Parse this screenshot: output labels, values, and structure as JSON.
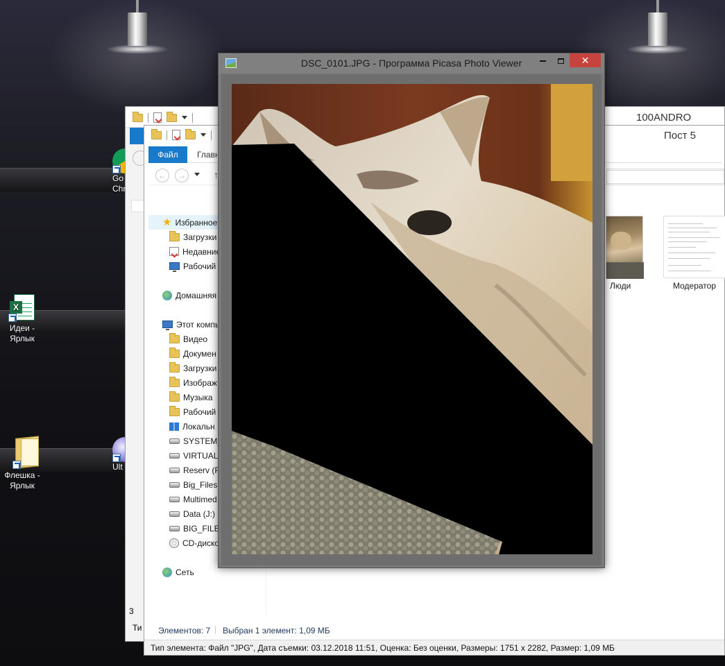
{
  "desktop": {
    "icons": [
      {
        "label": "Go\nChr"
      },
      {
        "label": "Идеи -\nЯрлык"
      },
      {
        "label": "Флешка -\nЯрлык"
      },
      {
        "label": "Ult"
      }
    ]
  },
  "explorer_back": {
    "title": "100ANDRO"
  },
  "explorer_front": {
    "title": "Пост 5",
    "tabs": {
      "file": "Файл",
      "home": "Главн"
    },
    "nav": {
      "back_icon": "arrow-left-icon",
      "forward_icon": "arrow-right-icon",
      "up_icon": "arrow-up-icon"
    },
    "nav_pane": [
      {
        "label": "Избранное",
        "icon": "star-icon"
      },
      {
        "label": "Загрузки",
        "icon": "downloads-folder-icon"
      },
      {
        "label": "Недавние",
        "icon": "recent-places-icon"
      },
      {
        "label": "Рабочий",
        "icon": "desktop-icon"
      },
      {
        "label": "Домашняя",
        "icon": "homegroup-icon"
      },
      {
        "label": "Этот компь",
        "icon": "this-pc-icon"
      },
      {
        "label": "Видео",
        "icon": "videos-folder-icon"
      },
      {
        "label": "Докумен",
        "icon": "documents-folder-icon"
      },
      {
        "label": "Загрузки",
        "icon": "downloads-folder-icon"
      },
      {
        "label": "Изображ",
        "icon": "pictures-folder-icon"
      },
      {
        "label": "Музыка",
        "icon": "music-folder-icon"
      },
      {
        "label": "Рабочий",
        "icon": "desktop-folder-icon"
      },
      {
        "label": "Локальн",
        "icon": "windows-drive-icon"
      },
      {
        "label": "SYSTEM_",
        "icon": "drive-icon"
      },
      {
        "label": "VIRTUAL",
        "icon": "drive-icon"
      },
      {
        "label": "Reserv (F:",
        "icon": "drive-icon"
      },
      {
        "label": "Big_Files",
        "icon": "drive-icon"
      },
      {
        "label": "Multimed",
        "icon": "drive-icon"
      },
      {
        "label": "Data (J:)",
        "icon": "drive-icon"
      },
      {
        "label": "BIG_FILES",
        "icon": "drive-icon"
      },
      {
        "label": "CD-диско",
        "icon": "cd-drive-icon"
      },
      {
        "label": "Сеть",
        "icon": "network-icon"
      }
    ],
    "files": [
      {
        "label": "Люди"
      },
      {
        "label": "Модератор"
      }
    ],
    "status": {
      "items": "Элементов: 7",
      "selected": "Выбран 1 элемент: 1,09 МБ",
      "partial": "Ти",
      "partial2": "3"
    },
    "info": "Тип элемента: Файл \"JPG\", Дата съемки: 03.12.2018 11:51, Оценка: Без оценки, Размеры: 1751 x 2282, Размер: 1,09 МБ"
  },
  "picasa": {
    "title": "DSC_0101.JPG - Программа Picasa Photo Viewer",
    "close_label": "✕"
  }
}
